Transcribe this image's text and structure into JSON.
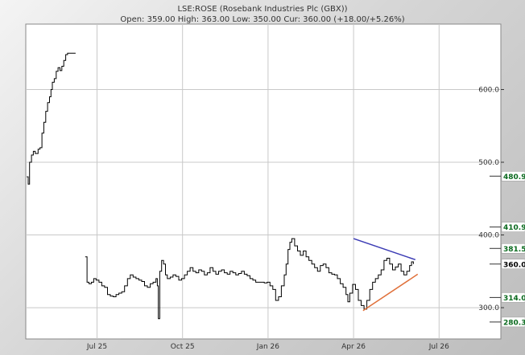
{
  "header": {
    "title": "LSE:ROSE (Rosebank Industries Plc (GBX))",
    "subtitle": "Open: 359.00 High: 363.00 Low: 350.00 Cur: 360.00 (+18.00/+5.26%)"
  },
  "chart_data": {
    "type": "line",
    "title": "LSE:ROSE (Rosebank Industries Plc (GBX))",
    "subtitle": "Open: 359.00 High: 363.00 Low: 350.00 Cur: 360.00 (+18.00/+5.26%)",
    "ylim": [
      257,
      690
    ],
    "xlim": [
      0,
      100
    ],
    "x_ticks": [
      {
        "label": "Jul 25",
        "x": 15
      },
      {
        "label": "Oct 25",
        "x": 33
      },
      {
        "label": "Jan 26",
        "x": 51
      },
      {
        "label": "Apr 26",
        "x": 69
      },
      {
        "label": "Jul 26",
        "x": 87
      }
    ],
    "y_ticks": [
      300,
      400,
      500,
      600
    ],
    "y_tick_labels": [
      "300.0",
      "400.0",
      "500.0",
      "600.0"
    ],
    "grid": true,
    "series": [
      {
        "name": "",
        "segments": [
          [
            [
              0.2,
              480
            ],
            [
              0.5,
              470
            ],
            [
              0.8,
              500
            ],
            [
              1.2,
              510
            ],
            [
              1.6,
              515
            ],
            [
              2.0,
              512
            ],
            [
              2.6,
              518
            ],
            [
              3.0,
              520
            ],
            [
              3.4,
              540
            ],
            [
              3.8,
              555
            ],
            [
              4.2,
              570
            ],
            [
              4.6,
              582
            ],
            [
              5.0,
              590
            ],
            [
              5.3,
              600
            ],
            [
              5.6,
              610
            ],
            [
              6.0,
              615
            ],
            [
              6.4,
              625
            ],
            [
              6.8,
              630
            ],
            [
              7.2,
              626
            ],
            [
              7.6,
              632
            ],
            [
              8.0,
              640
            ],
            [
              8.4,
              648
            ],
            [
              8.8,
              650
            ],
            [
              10.5,
              650
            ]
          ],
          [
            [
              12.5,
              370
            ],
            [
              12.9,
              335
            ],
            [
              13.3,
              333
            ],
            [
              13.8,
              335
            ],
            [
              14.3,
              340
            ],
            [
              14.8,
              338
            ],
            [
              15.4,
              335
            ],
            [
              16.0,
              330
            ],
            [
              16.6,
              328
            ],
            [
              17.2,
              318
            ],
            [
              17.8,
              316
            ],
            [
              18.4,
              315
            ],
            [
              19.0,
              318
            ],
            [
              19.6,
              320
            ],
            [
              20.2,
              322
            ],
            [
              20.8,
              330
            ],
            [
              21.4,
              340
            ],
            [
              22.0,
              345
            ],
            [
              22.6,
              342
            ],
            [
              23.2,
              340
            ],
            [
              23.8,
              338
            ],
            [
              24.4,
              336
            ],
            [
              25.0,
              330
            ],
            [
              25.6,
              328
            ],
            [
              26.2,
              333
            ],
            [
              26.8,
              335
            ],
            [
              27.4,
              340
            ],
            [
              27.7,
              330
            ],
            [
              27.9,
              285
            ],
            [
              28.2,
              350
            ],
            [
              28.6,
              365
            ],
            [
              29.0,
              360
            ],
            [
              29.4,
              345
            ],
            [
              29.8,
              340
            ],
            [
              30.4,
              342
            ],
            [
              31.0,
              345
            ],
            [
              31.6,
              343
            ],
            [
              32.2,
              338
            ],
            [
              32.8,
              340
            ],
            [
              33.4,
              345
            ],
            [
              34.0,
              350
            ],
            [
              34.6,
              355
            ],
            [
              35.2,
              350
            ],
            [
              35.8,
              348
            ],
            [
              36.4,
              352
            ],
            [
              37.0,
              350
            ],
            [
              37.6,
              345
            ],
            [
              38.2,
              348
            ],
            [
              38.8,
              355
            ],
            [
              39.4,
              350
            ],
            [
              40.0,
              346
            ],
            [
              40.6,
              350
            ],
            [
              41.2,
              352
            ],
            [
              41.8,
              348
            ],
            [
              42.4,
              346
            ],
            [
              43.0,
              350
            ],
            [
              43.6,
              348
            ],
            [
              44.2,
              345
            ],
            [
              44.8,
              347
            ],
            [
              45.4,
              350
            ],
            [
              46.0,
              346
            ],
            [
              46.6,
              344
            ],
            [
              47.2,
              340
            ],
            [
              47.8,
              338
            ],
            [
              48.4,
              335
            ],
            [
              49.0,
              335
            ],
            [
              49.6,
              335
            ],
            [
              50.2,
              334
            ],
            [
              50.8,
              335
            ],
            [
              51.4,
              330
            ],
            [
              52.0,
              325
            ],
            [
              52.6,
              310
            ],
            [
              53.2,
              315
            ],
            [
              53.8,
              330
            ],
            [
              54.4,
              345
            ],
            [
              54.8,
              360
            ],
            [
              55.2,
              380
            ],
            [
              55.6,
              390
            ],
            [
              56.0,
              395
            ],
            [
              56.6,
              385
            ],
            [
              57.2,
              378
            ],
            [
              57.8,
              372
            ],
            [
              58.4,
              378
            ],
            [
              59.0,
              370
            ],
            [
              59.6,
              365
            ],
            [
              60.2,
              360
            ],
            [
              60.8,
              355
            ],
            [
              61.4,
              350
            ],
            [
              62.0,
              358
            ],
            [
              62.6,
              360
            ],
            [
              63.2,
              355
            ],
            [
              63.8,
              348
            ],
            [
              64.4,
              346
            ],
            [
              65.0,
              345
            ],
            [
              65.6,
              340
            ],
            [
              66.2,
              333
            ],
            [
              66.8,
              328
            ],
            [
              67.4,
              318
            ],
            [
              67.8,
              308
            ],
            [
              68.2,
              320
            ],
            [
              68.8,
              332
            ],
            [
              69.4,
              325
            ],
            [
              70.0,
              310
            ],
            [
              70.6,
              303
            ],
            [
              71.2,
              298
            ],
            [
              71.8,
              310
            ],
            [
              72.4,
              325
            ],
            [
              73.0,
              335
            ],
            [
              73.6,
              340
            ],
            [
              74.2,
              345
            ],
            [
              74.8,
              352
            ],
            [
              75.4,
              365
            ],
            [
              76.0,
              368
            ],
            [
              76.6,
              360
            ],
            [
              77.2,
              352
            ],
            [
              77.8,
              356
            ],
            [
              78.4,
              360
            ],
            [
              79.0,
              350
            ],
            [
              79.6,
              345
            ],
            [
              80.2,
              350
            ],
            [
              80.8,
              358
            ],
            [
              81.2,
              363
            ],
            [
              81.6,
              360
            ]
          ]
        ]
      }
    ],
    "trendlines": [
      {
        "color": "#3b3bb4",
        "points": [
          [
            69.0,
            395
          ],
          [
            82.0,
            366
          ]
        ]
      },
      {
        "color": "#e0703a",
        "points": [
          [
            71.0,
            296
          ],
          [
            82.5,
            346
          ]
        ]
      }
    ],
    "levels": [
      {
        "label": "480.9",
        "value": 480.9,
        "color": "#0a6a1e"
      },
      {
        "label": "410.9",
        "value": 410.9,
        "color": "#0a6a1e"
      },
      {
        "label": "381.5",
        "value": 381.5,
        "color": "#0a6a1e"
      },
      {
        "label": "360.0",
        "value": 360.0,
        "color": "#000000"
      },
      {
        "label": "314.0",
        "value": 314.0,
        "color": "#0a6a1e"
      },
      {
        "label": "280.3",
        "value": 280.3,
        "color": "#0a6a1e"
      }
    ],
    "colors": {
      "price": "#000000",
      "grid": "#c8c8c8",
      "plot_bg": "#ffffff",
      "badge_bg": "#ffffff"
    }
  }
}
